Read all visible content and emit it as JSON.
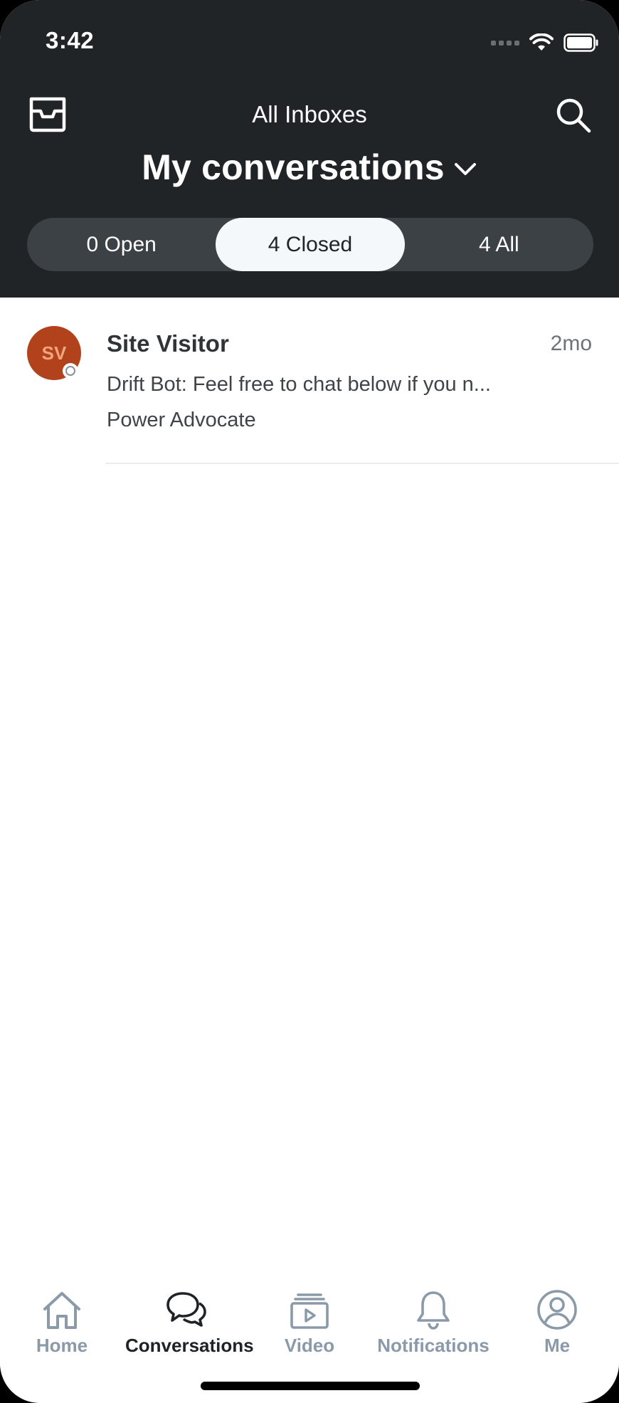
{
  "status_bar": {
    "time": "3:42"
  },
  "header": {
    "inbox_scope": "All Inboxes",
    "title": "My conversations",
    "segments": [
      {
        "label": "0 Open",
        "active": false
      },
      {
        "label": "4 Closed",
        "active": true
      },
      {
        "label": "4 All",
        "active": false
      }
    ]
  },
  "conversations": [
    {
      "initials": "SV",
      "name": "Site Visitor",
      "time": "2mo",
      "preview": "Drift Bot: Feel free to chat below if you n...",
      "subtitle": "Power Advocate",
      "avatar_color": "#b2421c"
    }
  ],
  "tabbar": {
    "tabs": [
      {
        "label": "Home",
        "icon": "home-icon",
        "active": false
      },
      {
        "label": "Conversations",
        "icon": "chat-bubbles-icon",
        "active": true
      },
      {
        "label": "Video",
        "icon": "video-icon",
        "active": false
      },
      {
        "label": "Notifications",
        "icon": "bell-icon",
        "active": false
      },
      {
        "label": "Me",
        "icon": "user-icon",
        "active": false
      }
    ]
  },
  "colors": {
    "header_bg": "#202427",
    "segment_bg": "#3c4146",
    "segment_active_bg": "#f5f8fb",
    "tab_inactive": "#8a9aa8",
    "tab_active": "#1f2326"
  }
}
